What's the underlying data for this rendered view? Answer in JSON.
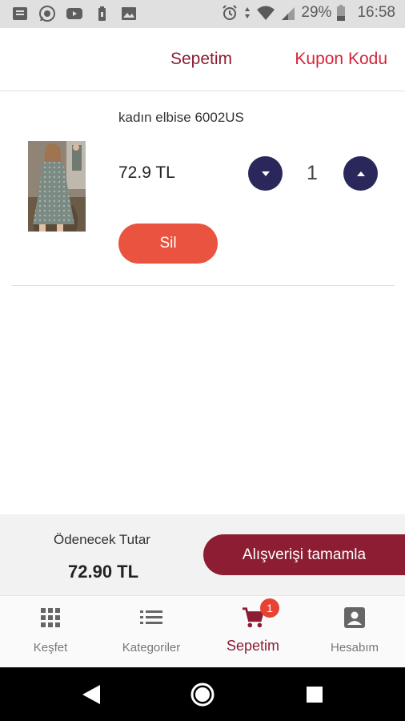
{
  "status_bar": {
    "battery": "29%",
    "time": "16:58",
    "left_icons": [
      "message-icon",
      "whatsapp-icon",
      "youtube-icon",
      "battery-saver-icon",
      "gallery-icon"
    ],
    "right_icons": [
      "alarm-icon",
      "data-arrows-icon",
      "wifi-icon",
      "signal-icon",
      "battery-icon"
    ]
  },
  "header": {
    "title": "Sepetim",
    "coupon_link": "Kupon Kodu"
  },
  "cart": {
    "items": [
      {
        "name": "kadın elbise 6002US",
        "price": "72.9 TL",
        "quantity": "1",
        "delete_label": "Sil",
        "image": "dress-photo"
      }
    ]
  },
  "summary": {
    "label": "Ödenecek Tutar",
    "total": "72.90 TL",
    "checkout_label": "Alışverişi tamamla"
  },
  "bottom_nav": {
    "items": [
      {
        "label": "Keşfet",
        "icon": "grid-icon",
        "active": false
      },
      {
        "label": "Kategoriler",
        "icon": "list-icon",
        "active": false
      },
      {
        "label": "Sepetim",
        "icon": "cart-icon",
        "active": true,
        "badge": "1"
      },
      {
        "label": "Hesabım",
        "icon": "account-icon",
        "active": false
      }
    ]
  },
  "colors": {
    "brand": "#8c1d33",
    "coupon": "#d6243a",
    "qty_button": "#2a275a",
    "delete_button": "#e9533f",
    "badge": "#e64334"
  }
}
